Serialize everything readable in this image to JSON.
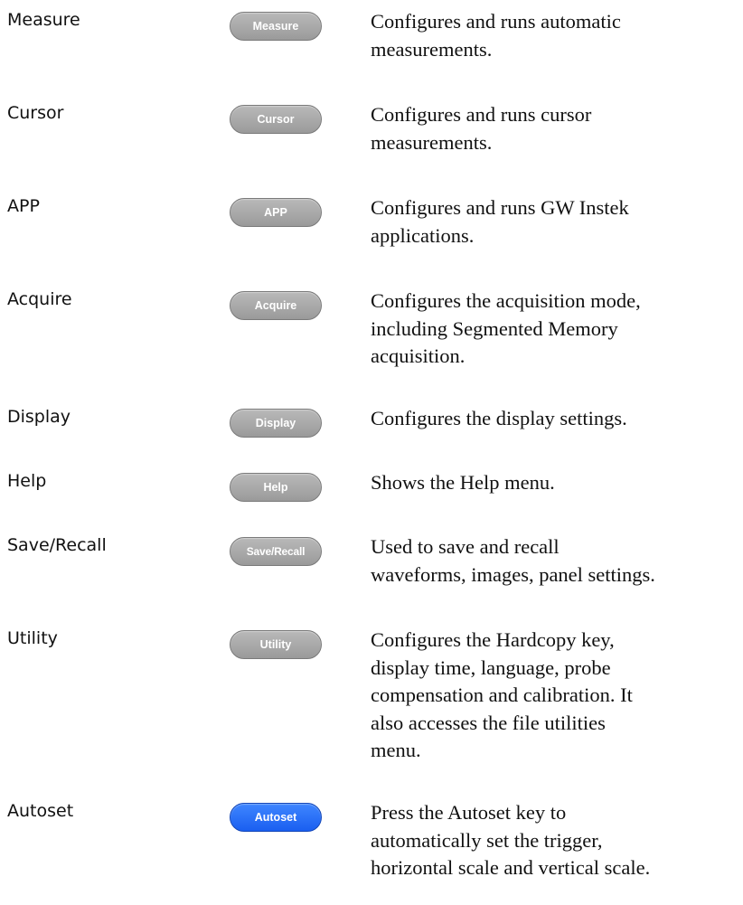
{
  "rows": [
    {
      "name": "Measure",
      "key": "Measure",
      "desc_lines": [
        "Configures and runs automatic",
        "measurements."
      ]
    },
    {
      "name": "Cursor",
      "key": "Cursor",
      "desc_lines": [
        "Configures and runs cursor",
        "measurements."
      ]
    },
    {
      "name": "APP",
      "key": "APP",
      "desc_lines": [
        "Configures and runs GW Instek",
        "applications."
      ]
    },
    {
      "name": "Acquire",
      "key": "Acquire",
      "desc_lines": [
        "Configures the acquisition mode,",
        "including Segmented Memory",
        "acquisition."
      ]
    },
    {
      "name": "Display",
      "key": "Display",
      "desc_lines": [
        "Configures the display settings."
      ]
    },
    {
      "name": "Help",
      "key": "Help",
      "desc_lines": [
        "Shows the Help menu."
      ]
    },
    {
      "name": "Save/Recall",
      "key": "Save/Recall",
      "desc_lines": [
        "Used to save and recall",
        "waveforms, images, panel settings."
      ]
    },
    {
      "name": "Utility",
      "key": "Utility",
      "desc_lines": [
        "Configures the Hardcopy key,",
        "display time, language, probe",
        "compensation and calibration.  It",
        "also accesses the file utilities",
        "menu."
      ]
    },
    {
      "name": "Autoset",
      "key": "Autoset",
      "desc_lines": [
        "Press the Autoset key to",
        "automatically set the trigger,",
        "horizontal scale and vertical scale."
      ]
    }
  ],
  "colors": {
    "gray_key": "#a8a8a8",
    "autoset_key": "#2a6ff5",
    "text": "#111111"
  }
}
